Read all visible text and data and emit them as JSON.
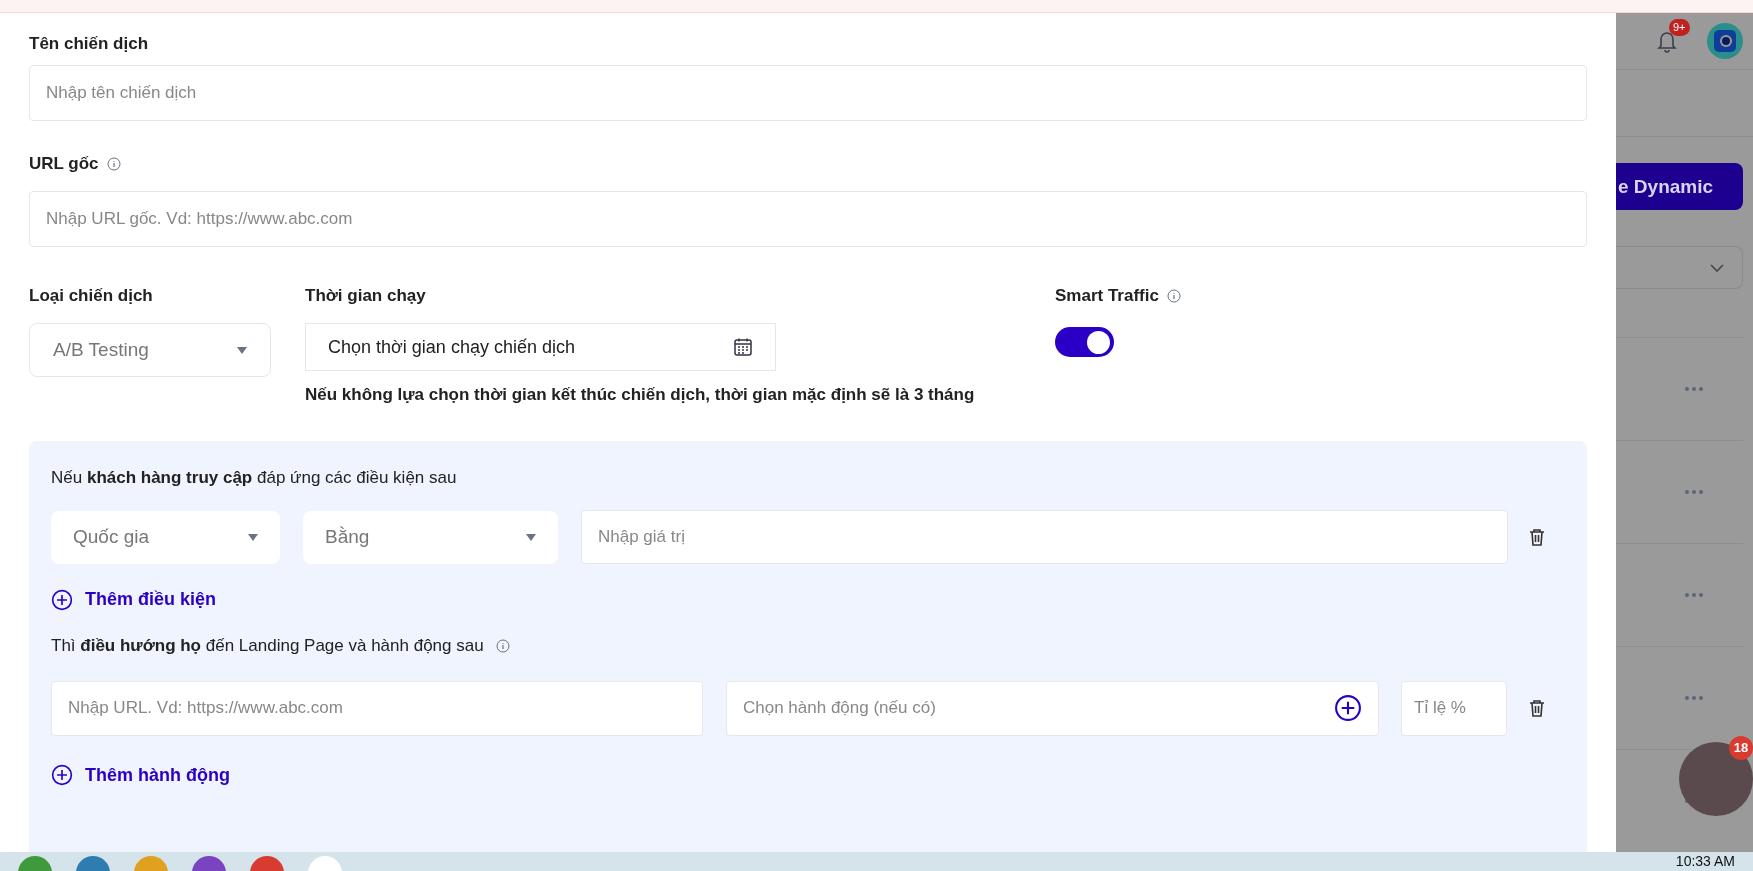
{
  "form": {
    "name_label": "Tên chiến dịch",
    "name_placeholder": "Nhập tên chiến dịch",
    "url_label": "URL gốc",
    "url_placeholder": "Nhập URL gốc. Vd: https://www.abc.com",
    "type_label": "Loại chiến dịch",
    "type_value": "A/B Testing",
    "time_label": "Thời gian chạy",
    "time_placeholder": "Chọn thời gian chạy chiến dịch",
    "time_note": "Nếu không lựa chọn thời gian kết thúc chiến dịch, thời gian mặc định sẽ là 3 tháng",
    "smart_traffic": {
      "label": "Smart Traffic",
      "on": true
    }
  },
  "rules": {
    "condition_text": "Nếu **khách hàng truy cập** đáp ứng các điều kiện sau",
    "conditions": [
      {
        "field": "Quốc gia",
        "operator": "Bằng",
        "value_placeholder": "Nhập giá trị"
      }
    ],
    "add_condition": "Thêm điều kiện",
    "redirect_text": "Thì **điều hướng họ** đến Landing Page và hành động sau",
    "actions": [
      {
        "url_placeholder": "Nhập URL. Vd: https://www.abc.com",
        "action_placeholder": "Chọn hành động (nếu có)",
        "ratio_placeholder": "Tỉ lệ %"
      }
    ],
    "add_action": "Thêm hành động"
  },
  "background": {
    "notification_badge": "9+",
    "button_label": "e Dynamic",
    "avatar_badge": "18"
  },
  "taskbar": {
    "time": "10:33 AM"
  }
}
